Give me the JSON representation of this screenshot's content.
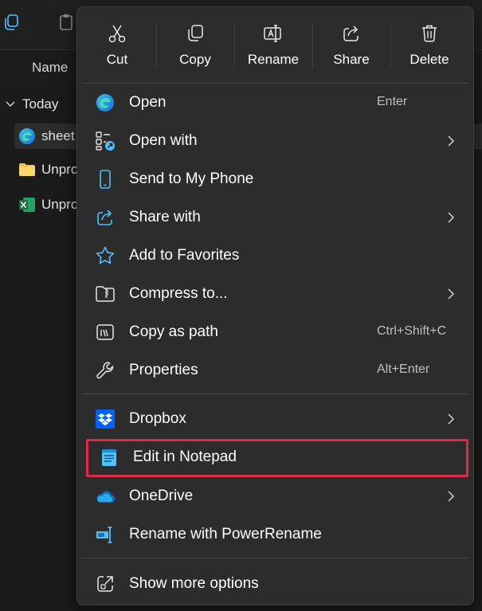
{
  "explorer": {
    "column_name": "Name",
    "group_label": "Today",
    "files": [
      {
        "name": "sheet",
        "icon": "edge-icon",
        "selected": true
      },
      {
        "name": "Unpro",
        "icon": "folder-icon",
        "selected": false
      },
      {
        "name": "Unpro",
        "icon": "excel-icon",
        "selected": false
      }
    ]
  },
  "context_menu": {
    "quick_actions": [
      {
        "label": "Cut",
        "icon": "scissors-icon"
      },
      {
        "label": "Copy",
        "icon": "copy-icon"
      },
      {
        "label": "Rename",
        "icon": "rename-icon"
      },
      {
        "label": "Share",
        "icon": "share-icon"
      },
      {
        "label": "Delete",
        "icon": "trash-icon"
      }
    ],
    "items": [
      {
        "label": "Open",
        "shortcut": "Enter",
        "icon": "edge-icon",
        "submenu": false
      },
      {
        "label": "Open with",
        "shortcut": "",
        "icon": "open-with-icon",
        "submenu": true
      },
      {
        "label": "Send to My Phone",
        "shortcut": "",
        "icon": "phone-icon",
        "submenu": false
      },
      {
        "label": "Share with",
        "shortcut": "",
        "icon": "share-icon",
        "submenu": true
      },
      {
        "label": "Add to Favorites",
        "shortcut": "",
        "icon": "star-icon",
        "submenu": false
      },
      {
        "label": "Compress to...",
        "shortcut": "",
        "icon": "zip-folder-icon",
        "submenu": true
      },
      {
        "label": "Copy as path",
        "shortcut": "Ctrl+Shift+C",
        "icon": "copy-path-icon",
        "submenu": false
      },
      {
        "label": "Properties",
        "shortcut": "Alt+Enter",
        "icon": "wrench-icon",
        "submenu": false
      },
      {
        "label": "Dropbox",
        "shortcut": "",
        "icon": "dropbox-icon",
        "submenu": true
      },
      {
        "label": "Edit in Notepad",
        "shortcut": "",
        "icon": "notepad-icon",
        "submenu": false,
        "highlighted": true
      },
      {
        "label": "OneDrive",
        "shortcut": "",
        "icon": "onedrive-icon",
        "submenu": true
      },
      {
        "label": "Rename with PowerRename",
        "shortcut": "",
        "icon": "powerrename-icon",
        "submenu": false
      },
      {
        "label": "Show more options",
        "shortcut": "",
        "icon": "show-more-icon",
        "submenu": false
      }
    ]
  },
  "colors": {
    "menu_bg": "#2c2c2c",
    "highlight_border": "#e0294a",
    "accent_blue": "#4cc2ff",
    "dropbox_blue": "#0061fe",
    "excel_green": "#1d6f42",
    "folder_yellow": "#f2c14e"
  }
}
